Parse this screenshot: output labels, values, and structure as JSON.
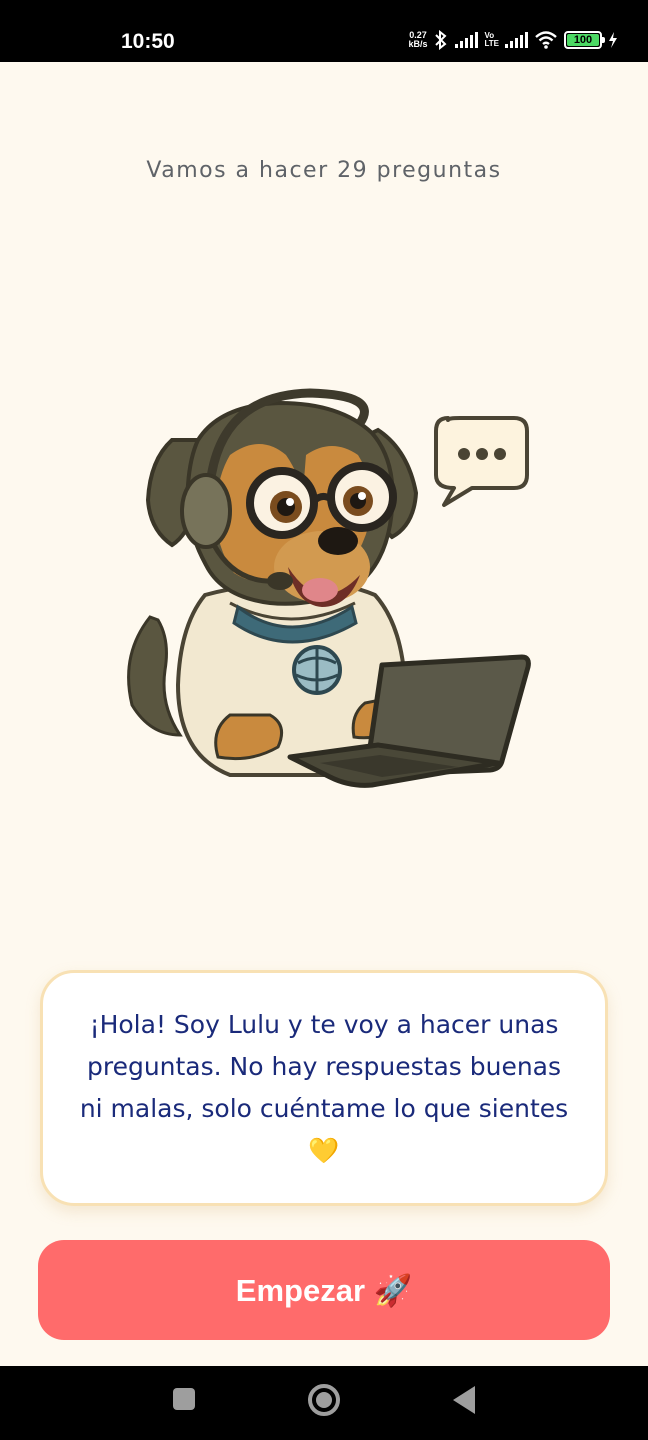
{
  "status_bar": {
    "time": "10:50",
    "speed_value": "0.27",
    "speed_unit": "kB/s",
    "lte_top": "Vo",
    "lte_bottom": "LTE",
    "battery": "100"
  },
  "intro": {
    "subtitle": "Vamos a hacer 29 preguntas",
    "message": "¡Hola! Soy Lulu y te voy a hacer unas preguntas. No hay respuestas buenas ni malas, solo cuéntame lo que sientes 💛",
    "start_label": "Empezar 🚀"
  },
  "icons": {
    "bluetooth": "bluetooth-icon",
    "signal": "signal-icon",
    "wifi": "wifi-icon",
    "battery": "battery-icon",
    "charging": "charging-icon",
    "mascot": "dog-mascot-illustration",
    "speech": "speech-bubble-icon"
  },
  "colors": {
    "background": "#FEF9EF",
    "primary_button": "#FF6B6B",
    "message_text": "#1A2A7A",
    "card_border": "#F8E1B4"
  }
}
